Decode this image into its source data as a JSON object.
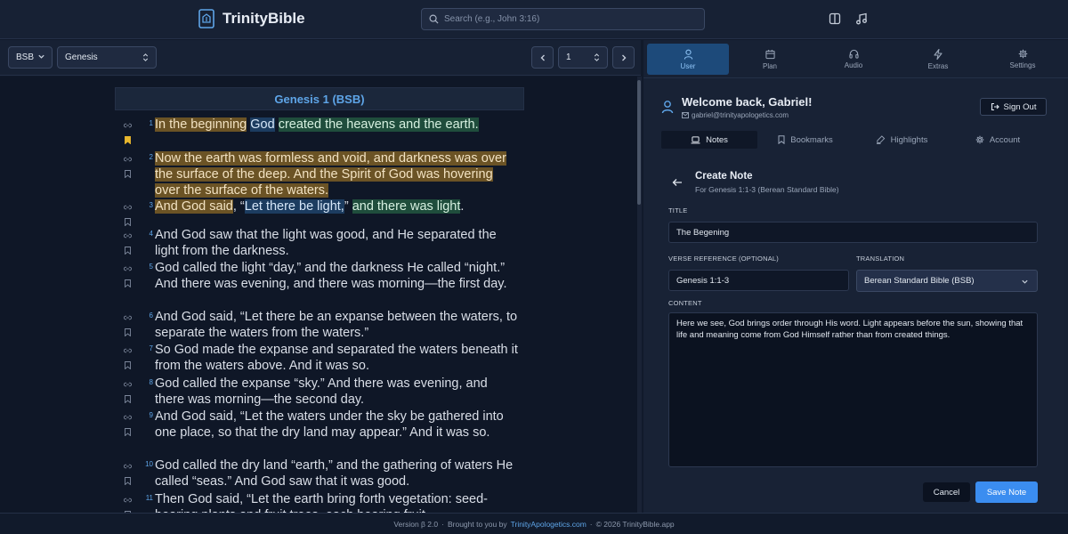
{
  "header": {
    "app_name": "TrinityBible",
    "search_placeholder": "Search (e.g., John 3:16)"
  },
  "toolbar": {
    "translation": "BSB",
    "book": "Genesis",
    "chapter": "1"
  },
  "reader": {
    "chapter_title": "Genesis 1 (BSB)",
    "verses": [
      {
        "num": "1",
        "parts": [
          {
            "t": "In the beginning",
            "h": "o"
          },
          {
            "t": " ",
            "h": ""
          },
          {
            "t": "God",
            "h": "b"
          },
          {
            "t": " ",
            "h": ""
          },
          {
            "t": "created the heavens and the earth.",
            "h": "g"
          }
        ],
        "bookmarked": true
      },
      {
        "num": "2",
        "parts": [
          {
            "t": "Now the earth was formless and void, and darkness was over the surface of the deep. And the Spirit of God was hovering over the surface of the waters.",
            "h": "o"
          }
        ],
        "bookmarked": false
      },
      {
        "num": "3",
        "parts": [
          {
            "t": "And God said",
            "h": "o"
          },
          {
            "t": ", “",
            "h": ""
          },
          {
            "t": "Let there be light,",
            "h": "b"
          },
          {
            "t": "” ",
            "h": ""
          },
          {
            "t": "and there was light",
            "h": "g"
          },
          {
            "t": ".",
            "h": ""
          }
        ],
        "bookmarked": false
      },
      {
        "num": "4",
        "parts": [
          {
            "t": "And God saw that the light was good, and He separated the light from the darkness.",
            "h": ""
          }
        ],
        "bookmarked": false
      },
      {
        "num": "5",
        "parts": [
          {
            "t": "God called the light “day,” and the darkness He called “night.” And there was evening, and there was morning—the first day.",
            "h": ""
          }
        ],
        "bookmarked": false
      },
      {
        "num": "6",
        "parts": [
          {
            "t": "And God said, “Let there be an expanse between the waters, to separate the waters from the waters.”",
            "h": ""
          }
        ],
        "bookmarked": false
      },
      {
        "num": "7",
        "parts": [
          {
            "t": "So God made the expanse and separated the waters beneath it from the waters above. And it was so.",
            "h": ""
          }
        ],
        "bookmarked": false
      },
      {
        "num": "8",
        "parts": [
          {
            "t": "God called the expanse “sky.” And there was evening, and there was morning—the second day.",
            "h": ""
          }
        ],
        "bookmarked": false
      },
      {
        "num": "9",
        "parts": [
          {
            "t": "And God said, “Let the waters under the sky be gathered into one place, so that the dry land may appear.” And it was so.",
            "h": ""
          }
        ],
        "bookmarked": false
      },
      {
        "num": "10",
        "parts": [
          {
            "t": "God called the dry land “earth,” and the gathering of waters He called “seas.” And God saw that it was good.",
            "h": ""
          }
        ],
        "bookmarked": false
      },
      {
        "num": "11",
        "parts": [
          {
            "t": "Then God said, “Let the earth bring forth vegetation: seed-bearing plants and fruit trees, each bearing fruit",
            "h": ""
          }
        ],
        "bookmarked": false
      }
    ]
  },
  "panel_tabs": [
    {
      "label": "User",
      "icon": "user-icon"
    },
    {
      "label": "Plan",
      "icon": "calendar-icon"
    },
    {
      "label": "Audio",
      "icon": "headphones-icon"
    },
    {
      "label": "Extras",
      "icon": "lightning-icon"
    },
    {
      "label": "Settings",
      "icon": "gear-icon"
    }
  ],
  "user": {
    "welcome": "Welcome back, Gabriel!",
    "email": "gabriel@trinityapologetics.com",
    "sign_out": "Sign Out"
  },
  "subtabs": [
    {
      "label": "Notes",
      "icon": "laptop-icon"
    },
    {
      "label": "Bookmarks",
      "icon": "bookmark-icon"
    },
    {
      "label": "Highlights",
      "icon": "highlighter-icon"
    },
    {
      "label": "Account",
      "icon": "gear-icon"
    }
  ],
  "note_form": {
    "title": "Create Note",
    "subtitle": "For Genesis 1:1-3 (Berean Standard Bible)",
    "title_label": "TITLE",
    "title_value": "The Begening",
    "ref_label": "VERSE REFERENCE (OPTIONAL)",
    "ref_value": "Genesis 1:1-3",
    "translation_label": "TRANSLATION",
    "translation_value": "Berean Standard Bible (BSB)",
    "content_label": "CONTENT",
    "content_value": "Here we see, God brings order through His word. Light appears before the sun, showing that life and meaning come from God Himself rather than from created things.",
    "cancel": "Cancel",
    "save": "Save Note"
  },
  "footer": {
    "version": "Version β 2.0",
    "sep": "·",
    "brought": "Brought to you by",
    "link": "TrinityApologetics.com",
    "copyright": "© 2026 TrinityBible.app"
  },
  "colors": {
    "accent": "#3b8df0",
    "highlight_orange": "#6b5325",
    "highlight_green": "#1f4d3c",
    "highlight_blue": "#1c3c60"
  }
}
